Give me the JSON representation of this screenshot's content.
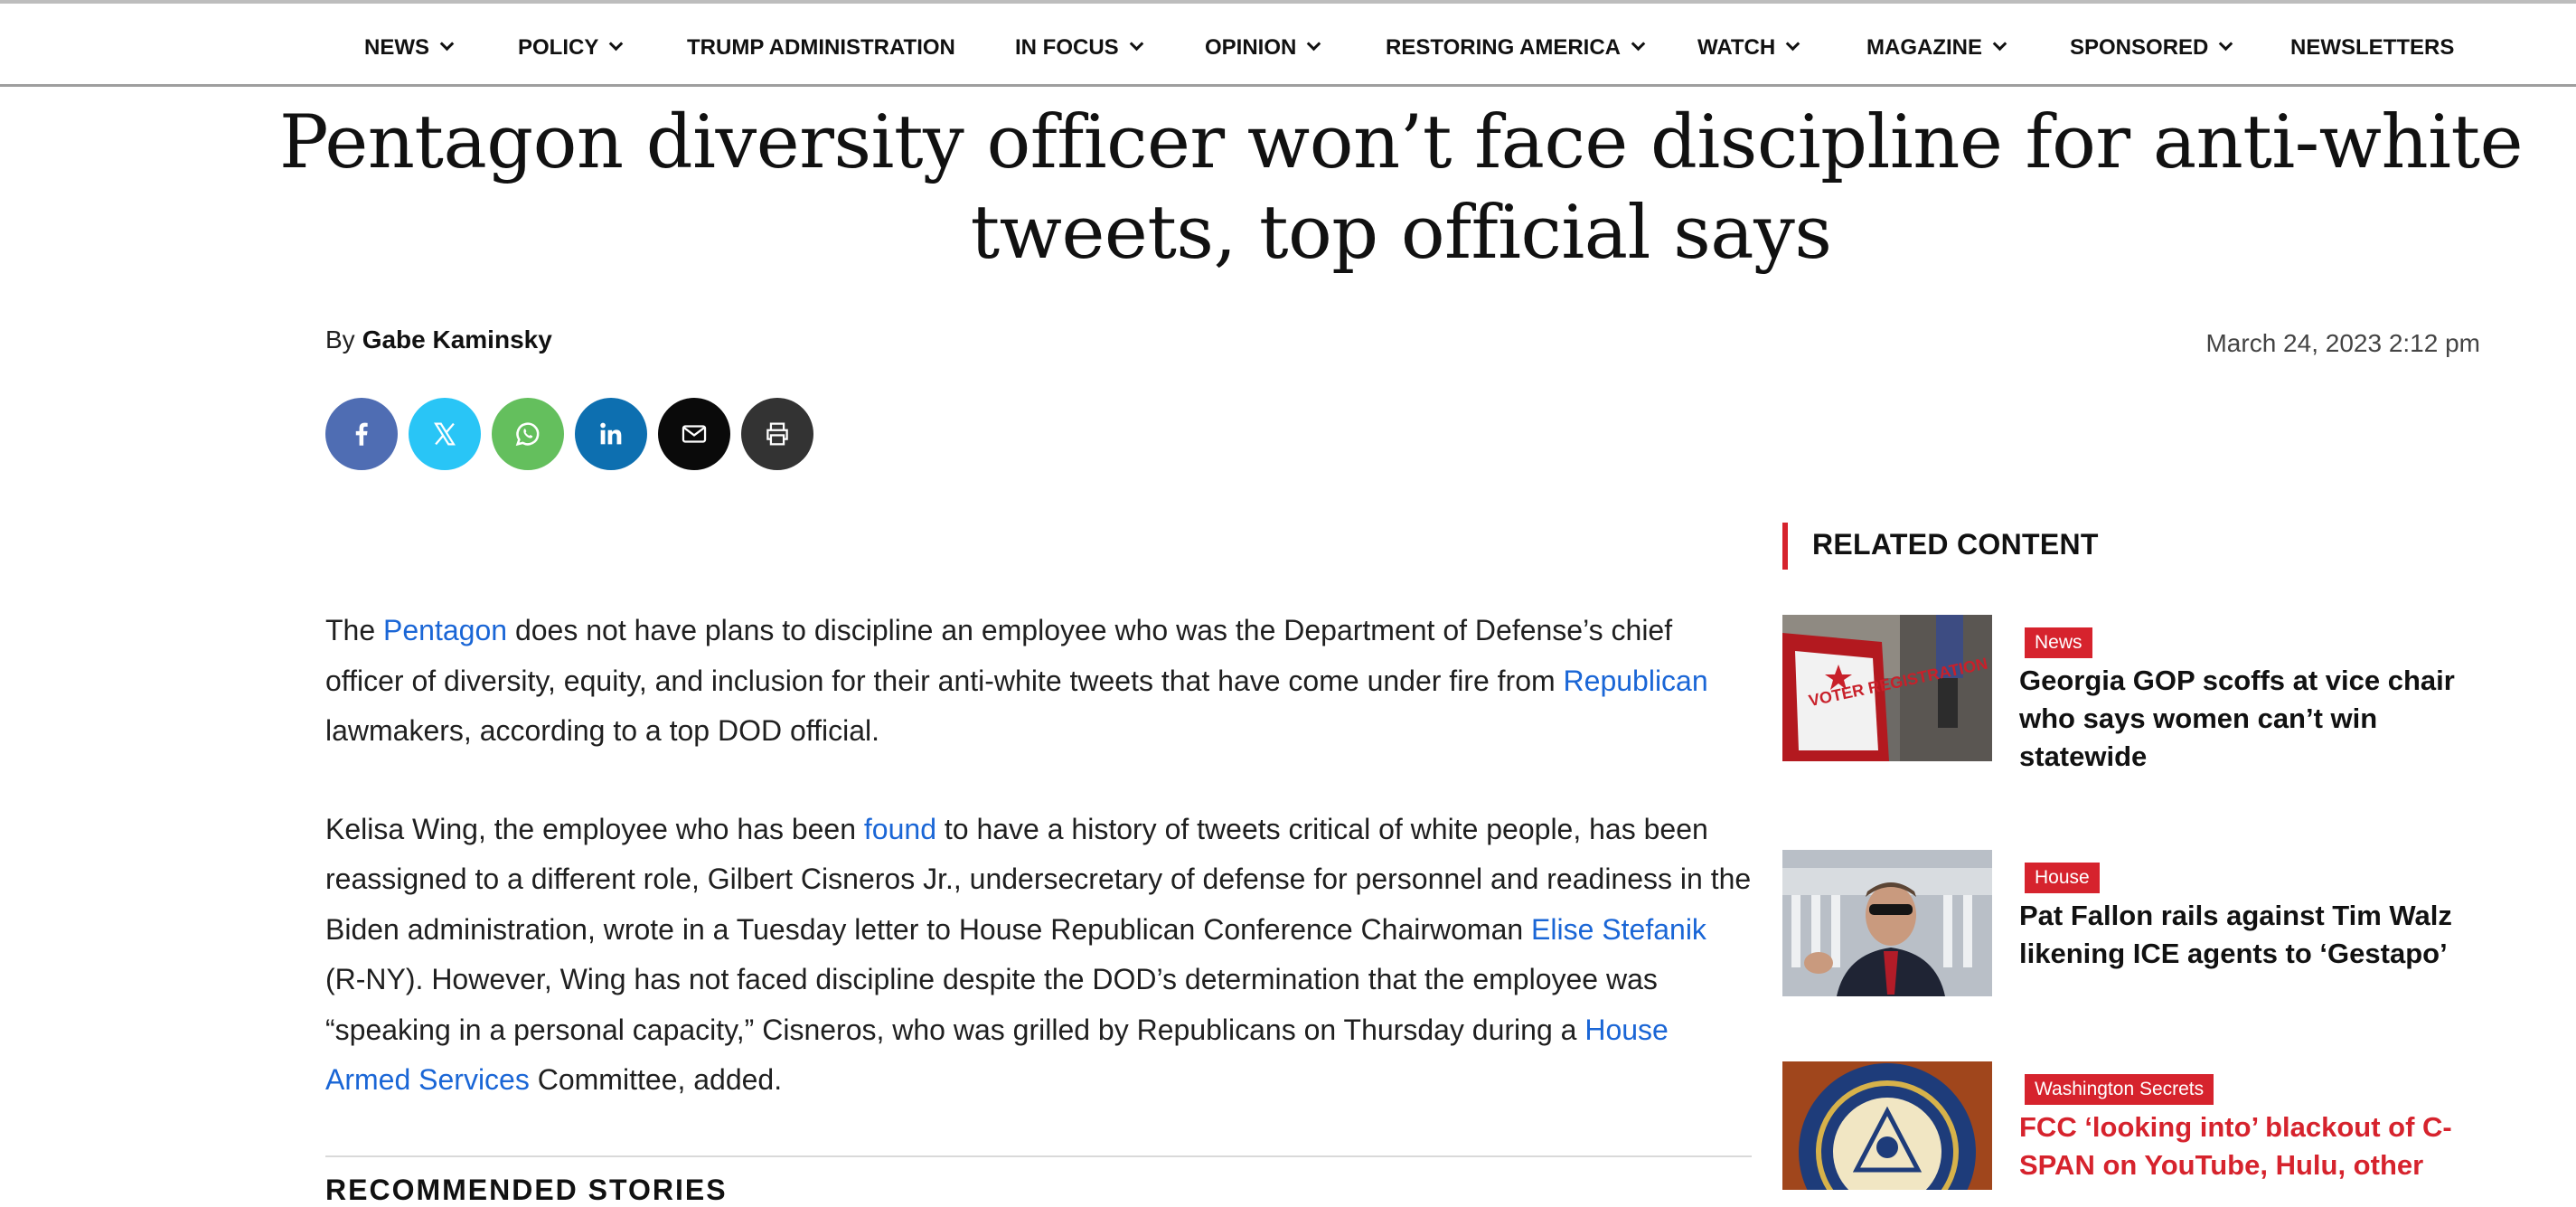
{
  "nav": {
    "items": [
      {
        "label": "NEWS",
        "has_menu": true
      },
      {
        "label": "POLICY",
        "has_menu": true
      },
      {
        "label": "TRUMP ADMINISTRATION",
        "has_menu": false
      },
      {
        "label": "IN FOCUS",
        "has_menu": true
      },
      {
        "label": "OPINION",
        "has_menu": true
      },
      {
        "label": "RESTORING AMERICA",
        "has_menu": true
      },
      {
        "label": "WATCH",
        "has_menu": true
      },
      {
        "label": "MAGAZINE",
        "has_menu": true
      },
      {
        "label": "SPONSORED",
        "has_menu": true
      },
      {
        "label": "NEWSLETTERS",
        "has_menu": false
      }
    ]
  },
  "article": {
    "headline": "Pentagon diversity officer won’t face discipline for anti-white tweets, top official says",
    "by_prefix": "By",
    "author": "Gabe Kaminsky",
    "date": "March 24, 2023 2:12 pm",
    "share": [
      {
        "icon": "facebook-icon",
        "color": "#4f6db3"
      },
      {
        "icon": "x-icon",
        "color": "#29c5f6"
      },
      {
        "icon": "whatsapp-icon",
        "color": "#64bf5d"
      },
      {
        "icon": "linkedin-icon",
        "color": "#0d6fb0"
      },
      {
        "icon": "email-icon",
        "color": "#0a0a0a"
      },
      {
        "icon": "print-icon",
        "color": "#333333"
      }
    ],
    "p1": {
      "t1": "The ",
      "link1": "Pentagon",
      "t2": " does not have plans to discipline an employee who was the Department of Defense’s chief officer of diversity, equity, and inclusion for their anti-white tweets that have come under fire from ",
      "link2": "Republican",
      "t3": " lawmakers, according to a top DOD official."
    },
    "p2": {
      "t1": "Kelisa Wing, the employee who has been ",
      "link1": "found",
      "t2": " to have a history of tweets critical of white people, has been reassigned to a different role, Gilbert Cisneros Jr., undersecretary of defense for personnel and readiness in the Biden administration, wrote in a Tuesday letter to House Republican Conference Chairwoman ",
      "link2": "Elise Stefanik",
      "t3": " (R-NY). However, Wing has not faced discipline despite the DOD’s determination that the employee was “speaking in a personal capacity,” Cisneros, who was grilled by Republicans on Thursday during a ",
      "link3": "House Armed Services",
      "t4": " Committee, added."
    },
    "recommended_heading": "RECOMMENDED STORIES"
  },
  "sidebar": {
    "title": "RELATED CONTENT",
    "accent": "#d6232d",
    "cards": [
      {
        "tag": "News",
        "title": "Georgia GOP scoffs at vice chair who says women can’t win statewide",
        "image_text": "VOTER REGISTRATION"
      },
      {
        "tag": "House",
        "title": "Pat Fallon rails against Tim Walz likening ICE agents to ‘Gestapo’"
      },
      {
        "tag": "Washington Secrets",
        "title": "FCC ‘looking into’ blackout of C-SPAN on YouTube, Hulu, other"
      }
    ]
  }
}
